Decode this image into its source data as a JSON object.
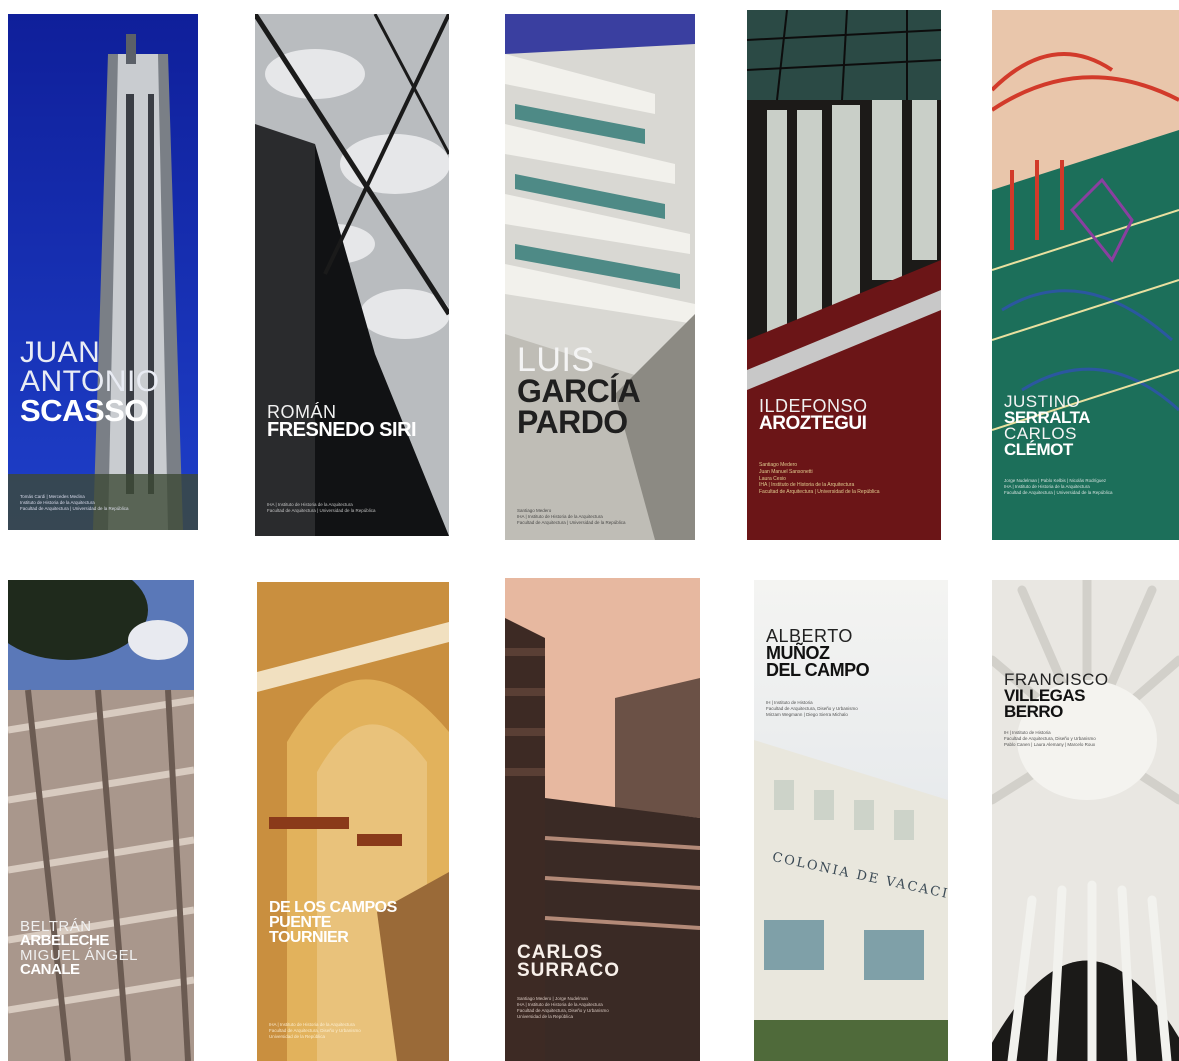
{
  "covers": [
    {
      "name": "cover-scasso",
      "lines": [
        "JUAN",
        "ANTONIO"
      ],
      "bold": [
        "SCASSO"
      ],
      "credits": [
        "Tomás Cardi | Mercedes Medina",
        "Instituto de Historia de la Arquitectura",
        "Facultad de Arquitectura | Universidad de la República"
      ]
    },
    {
      "name": "cover-fresnedo",
      "lines": [
        "ROMÁN"
      ],
      "bold": [
        "FRESNEDO SIRI"
      ],
      "credits": [
        "IHA | Instituto de Historia de la Arquitectura",
        "Facultad de Arquitectura | Universidad de la República"
      ]
    },
    {
      "name": "cover-garcia-pardo",
      "lines": [
        "LUIS"
      ],
      "bold": [
        "GARCÍA",
        "PARDO"
      ],
      "credits": [
        "Santiago Medero",
        "IHA | Instituto de Historia de la Arquitectura",
        "Facultad de Arquitectura | Universidad de la República"
      ]
    },
    {
      "name": "cover-aroztegui",
      "lines": [
        "ILDEFONSO"
      ],
      "bold": [
        "AROZTEGUI"
      ],
      "credits": [
        "Santiago Medero",
        "Juan Manuel Sansonetti",
        "Laura Cesio",
        "IHA | Instituto de Historia de la Arquitectura",
        "Facultad de Arquitectura | Universidad de la República"
      ]
    },
    {
      "name": "cover-serralta-clemot",
      "lines": [
        "JUSTINO"
      ],
      "bold": [
        "SERRALTA"
      ],
      "lines2": [
        "CARLOS"
      ],
      "bold2": [
        "CLÉMOT"
      ],
      "credits": [
        "Jorge Nudelman | Pablo Kelbis | Nicolás Rodríguez",
        "IHA | Instituto de Historia de la Arquitectura",
        "Facultad de Arquitectura | Universidad de la República"
      ]
    },
    {
      "name": "cover-arbeleche-canale",
      "lines": [
        "BELTRÁN"
      ],
      "bold": [
        "ARBELECHE"
      ],
      "lines2": [
        "MIGUEL ÁNGEL"
      ],
      "bold2": [
        "CANALE"
      ],
      "credits": []
    },
    {
      "name": "cover-de-los-campos",
      "lines": [],
      "bold": [
        "DE LOS CAMPOS",
        "PUENTE",
        "TOURNIER"
      ],
      "credits": [
        "IHA | Instituto de Historia de la Arquitectura",
        "Facultad de Arquitectura, Diseño y Urbanismo",
        "Universidad de la República"
      ]
    },
    {
      "name": "cover-surraco",
      "lines": [],
      "bold": [
        "CARLOS",
        "SURRACO"
      ],
      "credits": [
        "Santiago Medero | Jorge Nudelman",
        "IHA | Instituto de Historia de la Arquitectura",
        "Facultad de Arquitectura, Diseño y Urbanismo",
        "Universidad de la República"
      ]
    },
    {
      "name": "cover-munoz-del-campo",
      "lines": [
        "ALBERTO"
      ],
      "bold": [
        "MUÑOZ",
        "DEL CAMPO"
      ],
      "credits": [
        "IH | Instituto de Historia",
        "Facultad de Arquitectura, Diseño y Urbanismo",
        "Mirzam Wegmann | Diego Sierra Michalo"
      ],
      "sign": "COLONIA DE VACACIONES"
    },
    {
      "name": "cover-villegas-berro",
      "lines": [
        "FRANCISCO"
      ],
      "bold": [
        "VILLEGAS",
        "BERRO"
      ],
      "credits": [
        "IH | Instituto de Historia",
        "Facultad de Arquitectura, Diseño y Urbanismo",
        "Pablo Canen | Laura Alemany | Marcelo Roux"
      ]
    }
  ]
}
